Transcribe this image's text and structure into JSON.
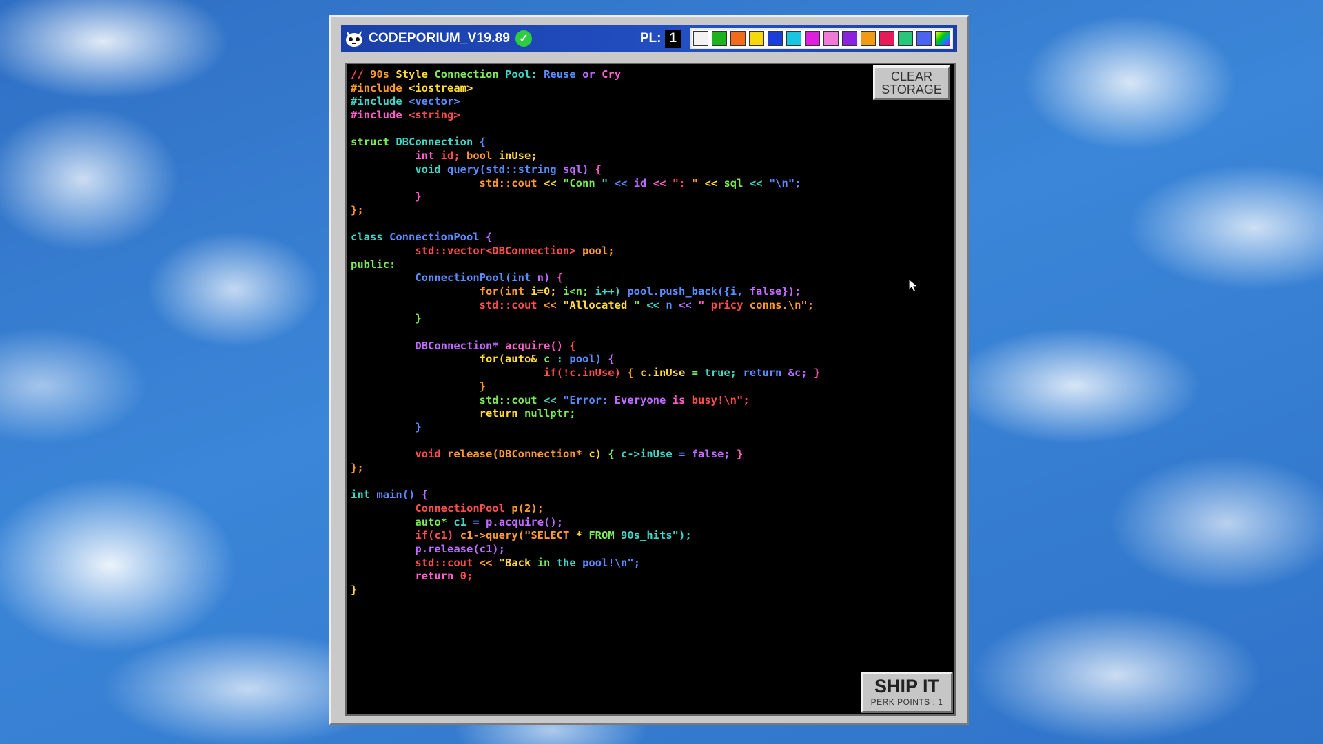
{
  "window": {
    "title": "CODEPORIUM_V19.89",
    "icon": "cat-face-icon",
    "status_icon": "check-icon",
    "pl_label": "PL:",
    "pl_value": "1",
    "palette": [
      "#f2f2f2",
      "#1db31d",
      "#f26a1b",
      "#f5d90a",
      "#1a3fd8",
      "#19c6e0",
      "#e01ee0",
      "#f07ad8",
      "#8a22e0",
      "#f29a12",
      "#e81a5a",
      "#27c77a",
      "#4a63f0",
      "rainbow"
    ]
  },
  "editor": {
    "clear_button": "CLEAR STORAGE",
    "ship_button": "SHIP IT",
    "perk_points": "PERK POINTS : 1",
    "code_colors": [
      "#ff4d4d",
      "#ff9a2e",
      "#ffd93a",
      "#7bea55",
      "#3fd6c8",
      "#5a8cff",
      "#c06bff",
      "#ff5fc8"
    ],
    "code_lines": [
      "// 90s Style Connection Pool: Reuse or Cry",
      "#include <iostream>",
      "#include <vector>",
      "#include <string>",
      "",
      "struct DBConnection {",
      "          int id; bool inUse;",
      "          void query(std::string sql) {",
      "                    std::cout << \"Conn \" << id << \": \" << sql << \"\\n\";",
      "          }",
      "};",
      "",
      "class ConnectionPool {",
      "          std::vector<DBConnection> pool;",
      "public:",
      "          ConnectionPool(int n) {",
      "                    for(int i=0; i<n; i++) pool.push_back({i, false});",
      "                    std::cout << \"Allocated \" << n << \" pricy conns.\\n\";",
      "          }",
      "",
      "          DBConnection* acquire() {",
      "                    for(auto& c : pool) {",
      "                              if(!c.inUse) { c.inUse = true; return &c; }",
      "                    }",
      "                    std::cout << \"Error: Everyone is busy!\\n\";",
      "                    return nullptr;",
      "          }",
      "",
      "          void release(DBConnection* c) { c->inUse = false; }",
      "};",
      "",
      "int main() {",
      "          ConnectionPool p(2);",
      "          auto* c1 = p.acquire();",
      "          if(c1) c1->query(\"SELECT * FROM 90s_hits\");",
      "          p.release(c1);",
      "          std::cout << \"Back in the pool!\\n\";",
      "          return 0;",
      "}"
    ]
  }
}
